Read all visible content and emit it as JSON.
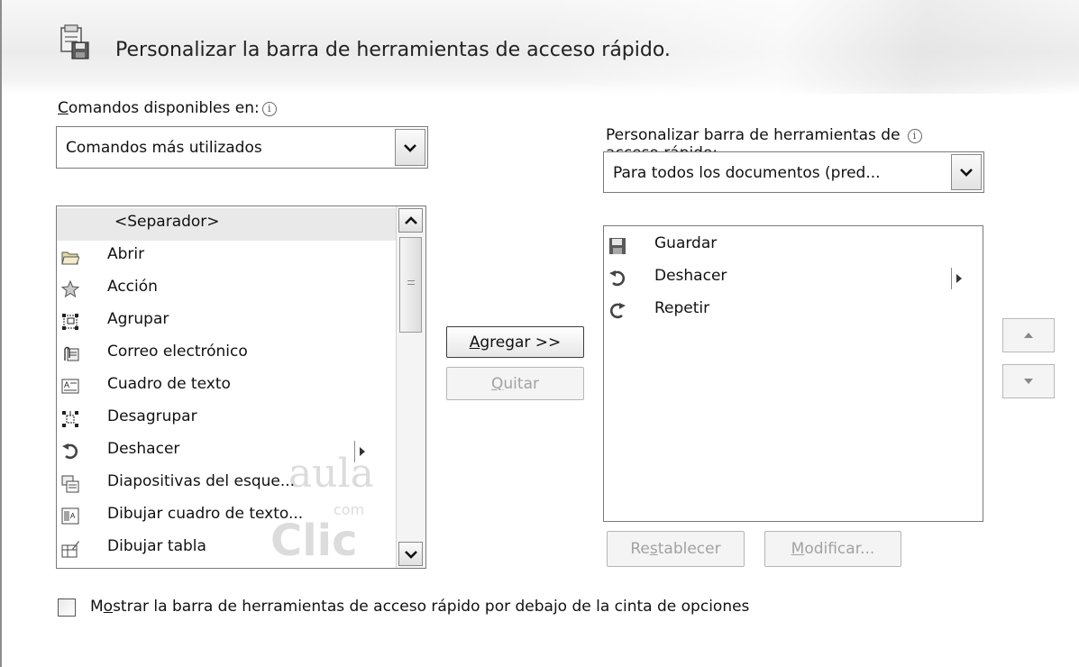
{
  "dialog": {
    "title": "Personalizar la barra de herramientas de acceso rápido."
  },
  "left_panel": {
    "label_prefix": "C",
    "label_rest": "omandos disponibles en:",
    "dropdown_value": "Comandos más utilizados",
    "commands": [
      {
        "label": "<Separador>",
        "icon": "separator",
        "selected": true
      },
      {
        "label": "Abrir",
        "icon": "open-folder-icon"
      },
      {
        "label": "Acción",
        "icon": "action-star-icon"
      },
      {
        "label": "Agrupar",
        "icon": "group-icon"
      },
      {
        "label": "Correo electrónico",
        "icon": "email-attachment-icon"
      },
      {
        "label": "Cuadro de texto",
        "icon": "text-box-icon"
      },
      {
        "label": "Desagrupar",
        "icon": "ungroup-icon"
      },
      {
        "label": "Deshacer",
        "icon": "undo-icon",
        "has_submenu": true
      },
      {
        "label": "Diapositivas del esque...",
        "icon": "outline-slides-icon"
      },
      {
        "label": "Dibujar cuadro de texto...",
        "icon": "draw-text-box-icon"
      },
      {
        "label": "Dibujar tabla",
        "icon": "draw-table-icon"
      }
    ]
  },
  "middle": {
    "add_prefix": "A",
    "add_rest": "gregar >>",
    "remove_prefix": "Q",
    "remove_rest": "uitar"
  },
  "right_panel": {
    "label_line1": "Personalizar barra de herramientas de",
    "label_line2_a": "acceso ",
    "label_line2_u": "r",
    "label_line2_b": "ápido:",
    "dropdown_value": "Para todos los documentos (pred...",
    "items": [
      {
        "label": "Guardar",
        "icon": "save-icon"
      },
      {
        "label": "Deshacer",
        "icon": "undo-icon",
        "has_submenu": true
      },
      {
        "label": "Repetir",
        "icon": "redo-icon"
      }
    ],
    "reset_prefix": "Re",
    "reset_u": "s",
    "reset_rest": "tablecer",
    "modify_u": "M",
    "modify_rest": "odificar..."
  },
  "footer": {
    "checkbox_pre": "M",
    "checkbox_u": "o",
    "checkbox_rest": "strar la barra de herramientas de acceso rápido por debajo de la cinta de opciones",
    "checked": false
  },
  "watermark": {
    "line1": "aula",
    "line2": "com",
    "line3": "Clic"
  },
  "colors": {
    "selected_row": "#e9e9e9",
    "header_bg": "#ececec",
    "disabled_text": "#a2a2a2"
  }
}
